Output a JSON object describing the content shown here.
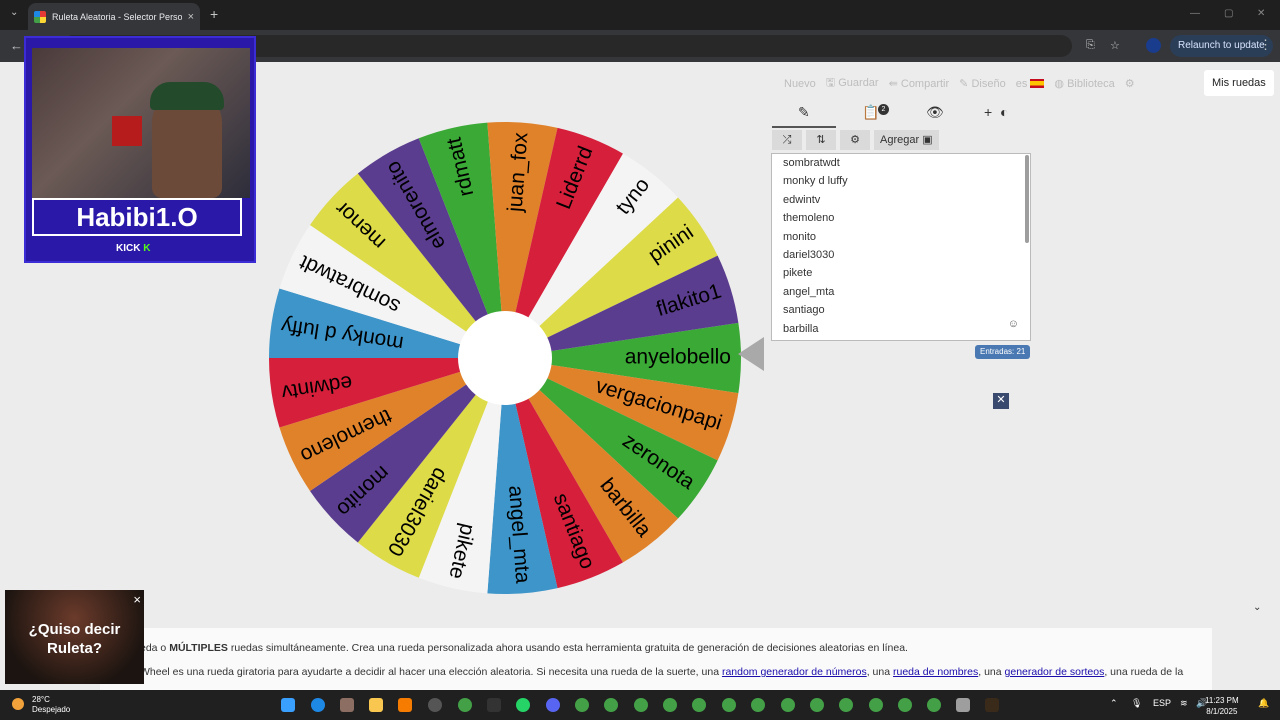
{
  "browser": {
    "tab_title": "Ruleta Aleatoria - Selector Personalizado",
    "tab_close": "×",
    "new_tab": "+",
    "relaunch_label": "Relaunch to update"
  },
  "nav": {
    "items": [
      "Nuevo",
      "Guardar",
      "Compartir",
      "Diseño",
      "es",
      "Biblioteca"
    ],
    "mis_ruedas": "Mis ruedas"
  },
  "panel": {
    "tabs": [
      "pencil-icon",
      "clipboard-icon",
      "eye-off-icon",
      "plus-icon"
    ],
    "results_badge": "2",
    "toolbar": {
      "add_label": "Agregar"
    },
    "entries_visible": [
      "sombratwdt",
      "monky d luffy",
      "edwintv",
      "themoleno",
      "monito",
      "dariel3030",
      "pikete",
      "angel_mta",
      "santiago",
      "barbilla"
    ],
    "entries_count": "Entradas: 21"
  },
  "wheel": {
    "segments": [
      {
        "label": "anyelobello",
        "color": "#3aa935"
      },
      {
        "label": "vergacionpapi",
        "color": "#e0822a"
      },
      {
        "label": "zeronota",
        "color": "#3aa935"
      },
      {
        "label": "barbilla",
        "color": "#e0822a"
      },
      {
        "label": "santiago",
        "color": "#d61f3a"
      },
      {
        "label": "angel_mta",
        "color": "#3d95c9"
      },
      {
        "label": "pikete",
        "color": "#f4f4f4"
      },
      {
        "label": "dariel3030",
        "color": "#dddb47"
      },
      {
        "label": "monito",
        "color": "#5b3d8f"
      },
      {
        "label": "themoleno",
        "color": "#e0822a"
      },
      {
        "label": "edwintv",
        "color": "#d61f3a"
      },
      {
        "label": "monky d luffy",
        "color": "#3d95c9"
      },
      {
        "label": "sombratwdt",
        "color": "#f4f4f4"
      },
      {
        "label": "menor",
        "color": "#dddb47"
      },
      {
        "label": "elmorenito",
        "color": "#5b3d8f"
      },
      {
        "label": "rdmatt",
        "color": "#3aa935"
      },
      {
        "label": "juan_fox",
        "color": "#e0822a"
      },
      {
        "label": "Liderrd",
        "color": "#d61f3a"
      },
      {
        "label": "tyno",
        "color": "#f4f4f4"
      },
      {
        "label": "pinini",
        "color": "#dddb47"
      },
      {
        "label": "flakito1",
        "color": "#5b3d8f"
      }
    ]
  },
  "article": {
    "line1_prefix": "eda o ",
    "line1_bold": "MÚLTIPLES",
    "line1_rest": " ruedas simultáneamente. Crea una rueda personalizada ahora usando esta herramienta gratuita de generación de decisiones aleatorias en línea.",
    "line2_a": "Wheel es una rueda giratoria para ayudarte a decidir al hacer una elección aleatoria. Si necesita una rueda de la suerte, una ",
    "link1": "random generador de números",
    "line2_b": ", una ",
    "link2": "rueda de nombres",
    "line2_c": ", una ",
    "link3": "generador de sorteos",
    "line2_d": ", una rueda de la"
  },
  "stream": {
    "name": "Habibi1.O",
    "platform": "KICK"
  },
  "ad": {
    "text": "¿Quiso decir Ruleta?",
    "close": "×"
  },
  "taskbar": {
    "temp": "28°C",
    "weather": "Despejado",
    "lang": "ESP",
    "time": "11:23 PM",
    "date": "8/1/2025"
  }
}
